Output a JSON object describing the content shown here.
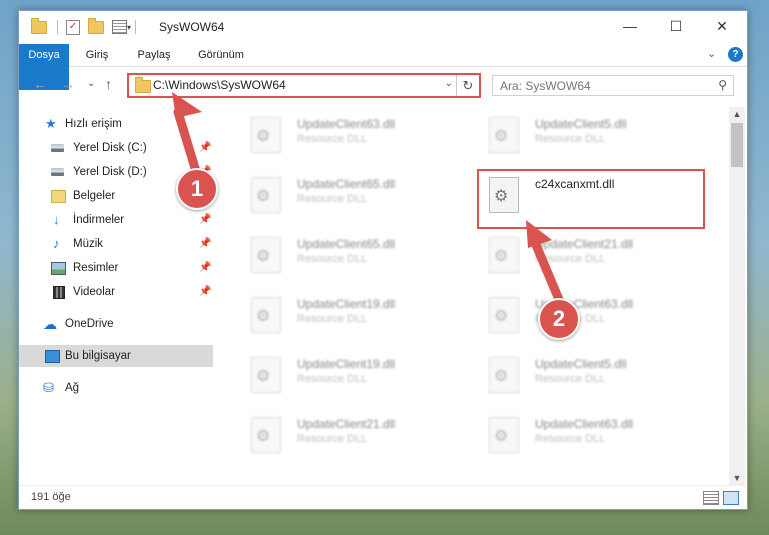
{
  "window": {
    "title": "SysWOW64"
  },
  "window_controls": {
    "minimize": "—",
    "maximize": "☐",
    "close": "✕"
  },
  "ribbon": {
    "tabs": [
      "Dosya",
      "Giriş",
      "Paylaş",
      "Görünüm"
    ],
    "expand": "⌄",
    "help": "?"
  },
  "address": {
    "path": "C:\\Windows\\SysWOW64",
    "dropdown": "⌄",
    "refresh": "↻",
    "search_placeholder": "Ara: SysWOW64",
    "search_icon": "⚲"
  },
  "nav_arrows": {
    "back": "←",
    "forward": "→",
    "recent": "⌄",
    "up": "↑"
  },
  "sidebar": {
    "items": [
      {
        "label": "Hızlı erişim"
      },
      {
        "label": "Yerel Disk (C:)",
        "pin": "📌"
      },
      {
        "label": "Yerel Disk (D:)",
        "pin": "📌"
      },
      {
        "label": "Belgeler",
        "pin": "📌"
      },
      {
        "label": "İndirmeler",
        "pin": "📌"
      },
      {
        "label": "Müzik",
        "pin": "📌"
      },
      {
        "label": "Resimler",
        "pin": "📌"
      },
      {
        "label": "Videolar",
        "pin": "📌"
      },
      {
        "label": "OneDrive"
      },
      {
        "label": "Bu bilgisayar"
      },
      {
        "label": "Ağ"
      }
    ]
  },
  "files": {
    "left": [
      {
        "name": "UpdateClient63.dll",
        "type": "Resource DLL"
      },
      {
        "name": "UpdateClient65.dll",
        "type": "Resource DLL"
      },
      {
        "name": "UpdateClient65.dll",
        "type": "Resource DLL"
      },
      {
        "name": "UpdateClient19.dll",
        "type": "Resource DLL"
      },
      {
        "name": "UpdateClient19.dll",
        "type": "Resource DLL"
      },
      {
        "name": "UpdateClient21.dll",
        "type": "Resource DLL"
      }
    ],
    "right": [
      {
        "name": "UpdateClient5.dll",
        "type": "Resource DLL"
      },
      {
        "name": "UpdateClient21.dll",
        "type": "Resource DLL"
      },
      {
        "name": "UpdateClient63.dll",
        "type": "Resource DLL"
      },
      {
        "name": "UpdateClient5.dll",
        "type": "Resource DLL"
      },
      {
        "name": "UpdateClient63.dll",
        "type": "Resource DLL"
      }
    ],
    "highlighted": {
      "name": "c24xcanxmt.dll"
    }
  },
  "scrollbar": {
    "up": "▲",
    "down": "▼"
  },
  "status": {
    "count": "191 öğe"
  },
  "annotations": {
    "step1": "1",
    "step2": "2",
    "color": "#d9534f"
  }
}
